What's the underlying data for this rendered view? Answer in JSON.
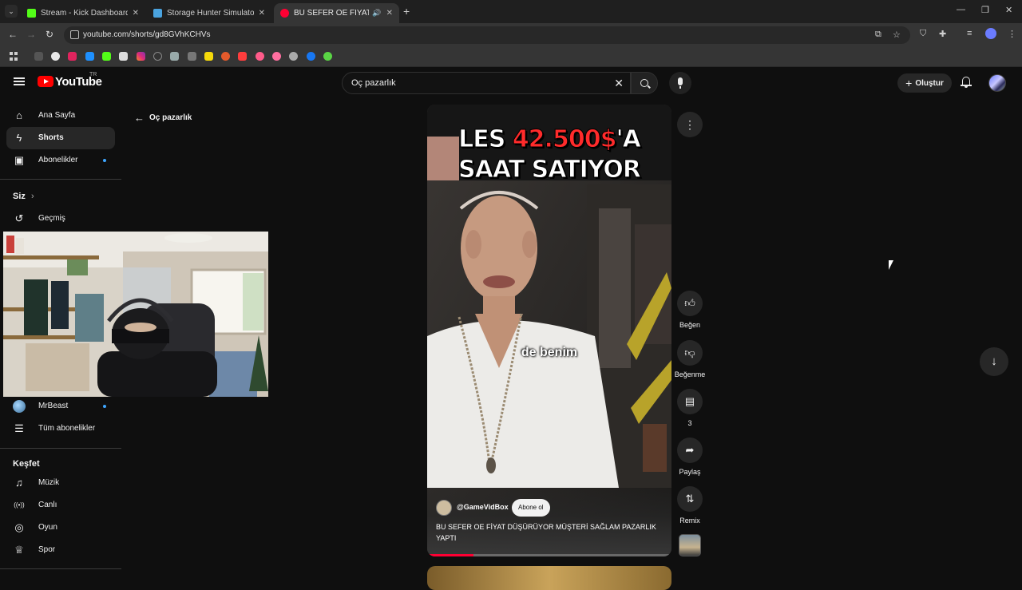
{
  "browser": {
    "tabs": [
      {
        "title": "Stream - Kick Dashboard",
        "favicon_color": "#53fc18"
      },
      {
        "title": "Storage Hunter Simulator Steam",
        "favicon_color": "#4aa3df"
      },
      {
        "title": "BU SEFER OE FİYAT DÜŞÜRÜ",
        "favicon_color": "#ff0033"
      }
    ],
    "url": "youtube.com/shorts/gd8GVhKCHVs"
  },
  "youtube": {
    "logo_text": "YouTube",
    "country": "TR",
    "search": {
      "value": "Oç pazarlık"
    },
    "create_label": "Oluştur"
  },
  "sidebar": {
    "items": [
      {
        "label": "Ana Sayfa",
        "icon": "home-icon",
        "glyph": "⌂"
      },
      {
        "label": "Shorts",
        "icon": "shorts-icon",
        "glyph": "ϟ"
      },
      {
        "label": "Abonelikler",
        "icon": "subscriptions-icon",
        "glyph": "▣"
      }
    ],
    "you_heading": "Siz",
    "history_label": "Geçmiş",
    "channel_label": "MrBeast",
    "all_subs_label": "Tüm abonelikler",
    "explore_heading": "Keşfet",
    "explore_items": [
      {
        "label": "Müzik",
        "icon": "music-icon",
        "glyph": "♫"
      },
      {
        "label": "Canlı",
        "icon": "live-icon",
        "glyph": "((•))"
      },
      {
        "label": "Oyun",
        "icon": "gaming-icon",
        "glyph": "◎"
      },
      {
        "label": "Spor",
        "icon": "trophy-icon",
        "glyph": "♕"
      }
    ]
  },
  "back_link": "Oç pazarlık",
  "short": {
    "caption_line1_a": "LES ",
    "caption_line1_price": "42.500$",
    "caption_line1_b": "'A",
    "caption_line2": "SAAT SATIYOR",
    "subtitle": "de benim",
    "channel": "@GameVidBox",
    "subscribe_label": "Abone ol",
    "title": "BU SEFER OE FİYAT DÜŞÜRÜYOR MÜŞTERİ SAĞLAM PAZARLIK YAPTI",
    "progress_fraction": 0.19
  },
  "actions": {
    "like_label": "Beğen",
    "dislike_label": "Beğenme",
    "comments_count": "3",
    "share_label": "Paylaş",
    "remix_label": "Remix"
  },
  "colors": {
    "accent_red": "#ff0033",
    "price_red": "#ff2b2b",
    "background": "#0f0f0f"
  }
}
